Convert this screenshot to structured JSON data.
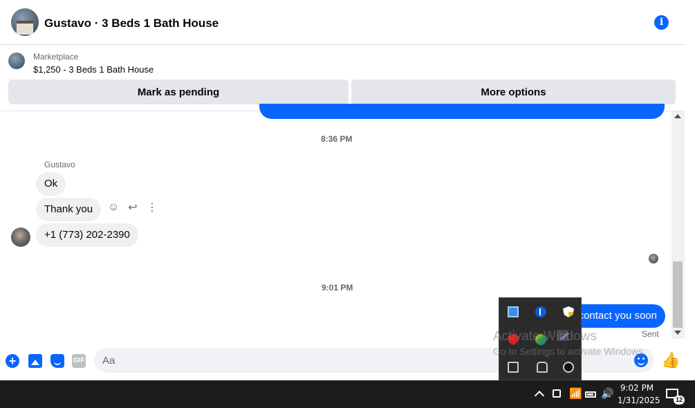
{
  "header": {
    "title": "Gustavo · 3 Beds 1 Bath House",
    "avatar_icon": "house-photo",
    "info_icon": "info-icon"
  },
  "marketplace": {
    "label": "Marketplace",
    "item": "$1,250 - 3 Beds 1 Bath House",
    "mark_pending_label": "Mark as pending",
    "more_options_label": "More options"
  },
  "conversation": {
    "timestamp_1": "8:36 PM",
    "sender_name": "Gustavo",
    "messages_in": [
      "Ok",
      "Thank you",
      "+1 (773) 202-2390"
    ],
    "timestamp_2": "9:01 PM",
    "message_out": "contact you soon",
    "status": "Sent"
  },
  "composer": {
    "placeholder": "Aa",
    "gif_label": "GIF"
  },
  "watermark": {
    "line1": "Activate Windows",
    "line2": "Go to Settings to activate Windows."
  },
  "taskbar": {
    "time": "9:02 PM",
    "date": "1/31/2025",
    "notification_count": "12"
  },
  "colors": {
    "accent": "#0866ff",
    "bubble_in": "#f0f0f0",
    "button_bg": "#e4e6eb"
  }
}
